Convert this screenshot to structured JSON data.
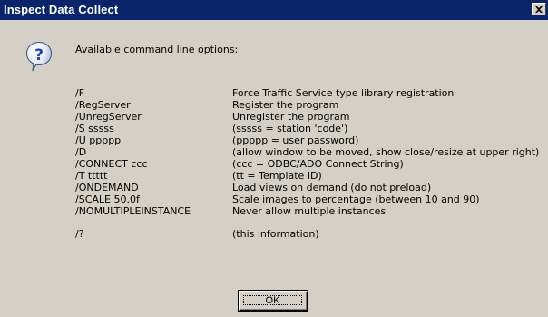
{
  "window": {
    "title": "Inspect Data Collect"
  },
  "message": {
    "icon": "question-icon",
    "header": "Available command line options:"
  },
  "options": [
    {
      "switch": "/F",
      "description": "Force Traffic Service type library registration"
    },
    {
      "switch": "/RegServer",
      "description": "Register the program"
    },
    {
      "switch": "/UnregServer",
      "description": "Unregister the program"
    },
    {
      "switch": "/S sssss",
      "description": "(sssss = station 'code')"
    },
    {
      "switch": "/U ppppp",
      "description": "(ppppp = user password)"
    },
    {
      "switch": "/D",
      "description": "(allow window to be moved, show close/resize at upper right)"
    },
    {
      "switch": "/CONNECT ccc",
      "description": "(ccc = ODBC/ADO Connect String)"
    },
    {
      "switch": "/T ttttt",
      "description": "(tt = Template ID)"
    },
    {
      "switch": "/ONDEMAND",
      "description": "Load views on demand (do not preload)"
    },
    {
      "switch": "/SCALE 50.0f",
      "description": "Scale images to percentage (between 10 and 90)"
    },
    {
      "switch": "/NOMULTIPLEINSTANCE",
      "description": "Never allow multiple instances"
    },
    {
      "switch": "/?",
      "description": "(this information)"
    }
  ],
  "buttons": {
    "ok_label": "OK"
  },
  "colors": {
    "titlebar": "#0a246a",
    "face": "#d4d0c8"
  }
}
